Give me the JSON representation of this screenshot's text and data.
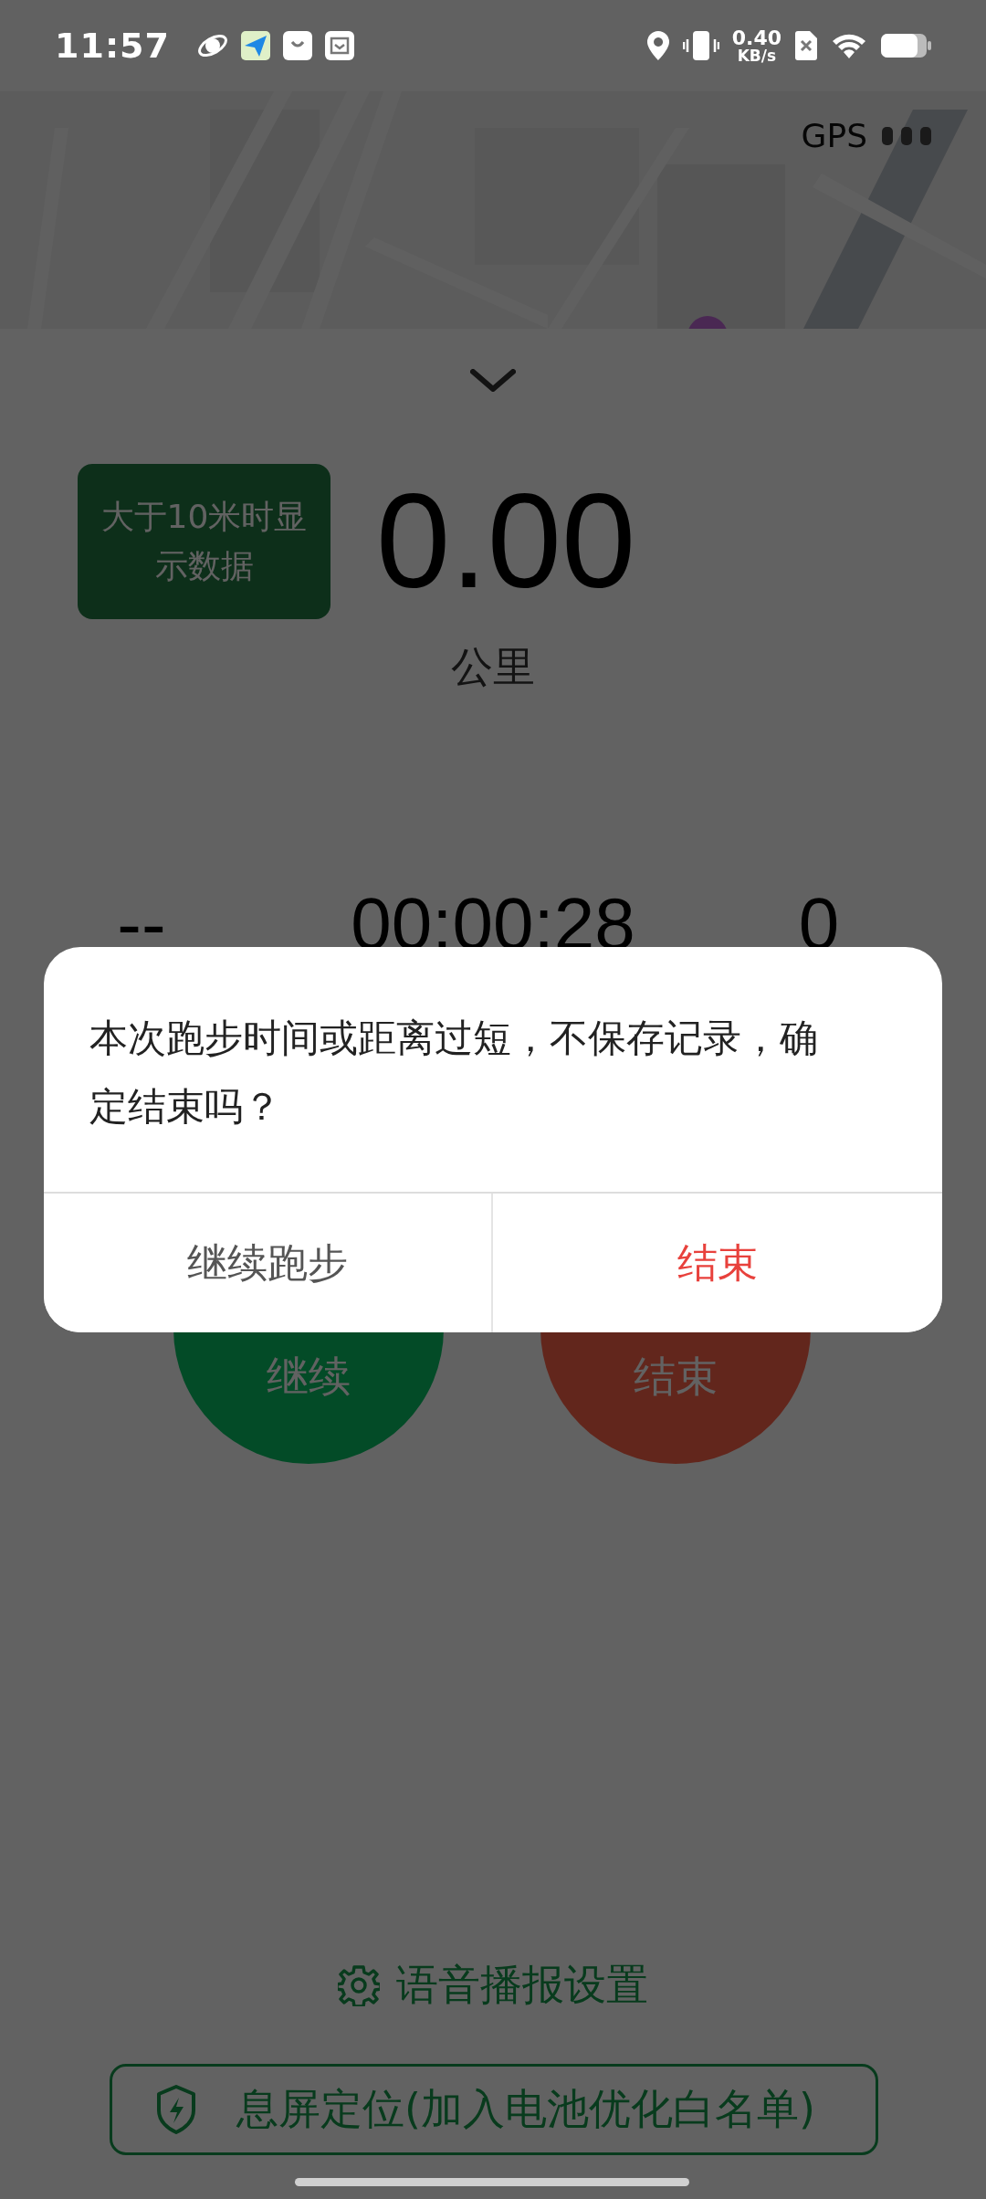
{
  "status_bar": {
    "time": "11:57",
    "net_speed_value": "0.40",
    "net_speed_unit": "KB/s"
  },
  "map": {
    "kind": "picture",
    "gps_label": "GPS"
  },
  "distance": {
    "notice": "大于10米时显示数据",
    "value": "0.00",
    "unit": "公里"
  },
  "stats": [
    {
      "value": "--"
    },
    {
      "value": "00:00:28"
    },
    {
      "value": "0"
    }
  ],
  "controls": [
    {
      "label": "继续",
      "kind": "resume"
    },
    {
      "label": "结束",
      "kind": "stop"
    }
  ],
  "voice_settings": "语音播报设置",
  "screen_off_button": "息屏定位(加入电池优化白名单)",
  "dialog": {
    "message": "本次跑步时间或距离过短，不保存记录，确定结束吗？",
    "buttons": [
      {
        "label": "继续跑步",
        "kind": "neutral"
      },
      {
        "label": "结束",
        "kind": "danger"
      }
    ]
  }
}
